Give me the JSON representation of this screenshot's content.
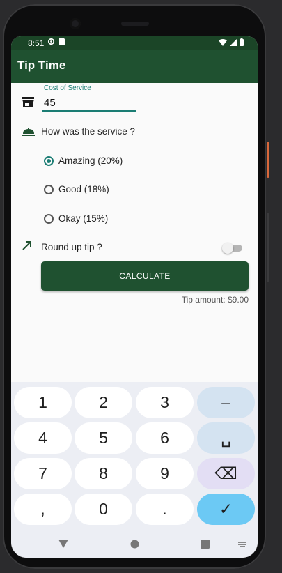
{
  "status_bar": {
    "time": "8:51",
    "icons": [
      "gear-icon",
      "sim-card-icon",
      "wifi-icon",
      "signal-icon",
      "battery-icon"
    ]
  },
  "app_bar": {
    "title": "Tip Time",
    "color": "#1f5130"
  },
  "cost_of_service": {
    "label": "Cost of Service",
    "value": "45",
    "icon": "store-icon"
  },
  "service_question": {
    "label": "How was the service ?",
    "icon": "room-service-icon"
  },
  "tip_options": [
    {
      "label": "Amazing (20%)",
      "selected": true
    },
    {
      "label": "Good (18%)",
      "selected": false
    },
    {
      "label": "Okay (15%)",
      "selected": false
    }
  ],
  "round_up": {
    "label": "Round up tip ?",
    "enabled": false,
    "icon": "trending-up-icon"
  },
  "calculate_button": {
    "label": "CALCULATE"
  },
  "tip_amount": {
    "text": "Tip amount: $9.00"
  },
  "keyboard": {
    "rows": [
      [
        "1",
        "2",
        "3",
        "–"
      ],
      [
        "4",
        "5",
        "6",
        "␣"
      ],
      [
        "7",
        "8",
        "9",
        "⌫"
      ],
      [
        ",",
        "0",
        ".",
        "✓"
      ]
    ]
  },
  "colors": {
    "accent": "#1b7d74",
    "primary_dark": "#1b4527",
    "button": "#1f5130"
  }
}
